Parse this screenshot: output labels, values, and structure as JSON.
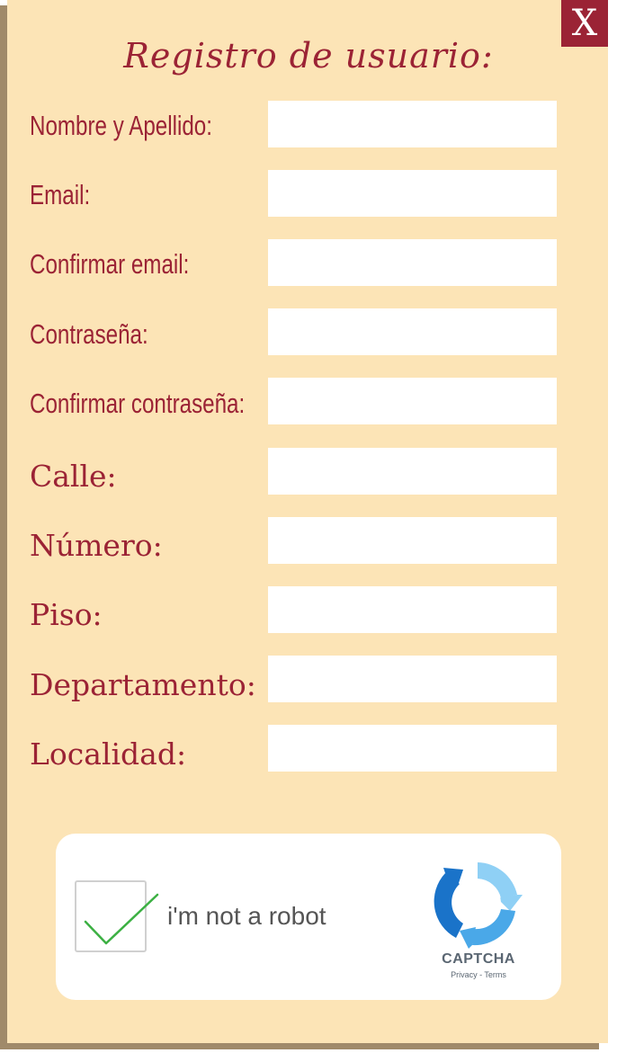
{
  "dialog": {
    "title": "Registro de usuario:",
    "close_label": "X"
  },
  "fields": [
    {
      "label": "Nombre y Apellido:",
      "value": ""
    },
    {
      "label": "Email:",
      "value": ""
    },
    {
      "label": "Confirmar email:",
      "value": ""
    },
    {
      "label": "Contraseña:",
      "value": ""
    },
    {
      "label": "Confirmar contraseña:",
      "value": ""
    },
    {
      "label": "Calle:",
      "value": ""
    },
    {
      "label": "Número:",
      "value": ""
    },
    {
      "label": "Piso:",
      "value": ""
    },
    {
      "label": "Departamento:",
      "value": ""
    },
    {
      "label": "Localidad:",
      "value": ""
    }
  ],
  "captcha": {
    "checkbox_label": "i'm not a robot",
    "checked": true,
    "brand": "CAPTCHA",
    "links": "Privacy - Terms",
    "check_color": "#3cb043",
    "logo_colors": [
      "#1a73c9",
      "#4aa8e8",
      "#8fd0f5"
    ]
  },
  "colors": {
    "accent": "#9b2335",
    "panel": "#fce4b6",
    "panel_shadow": "#a08a6a"
  }
}
